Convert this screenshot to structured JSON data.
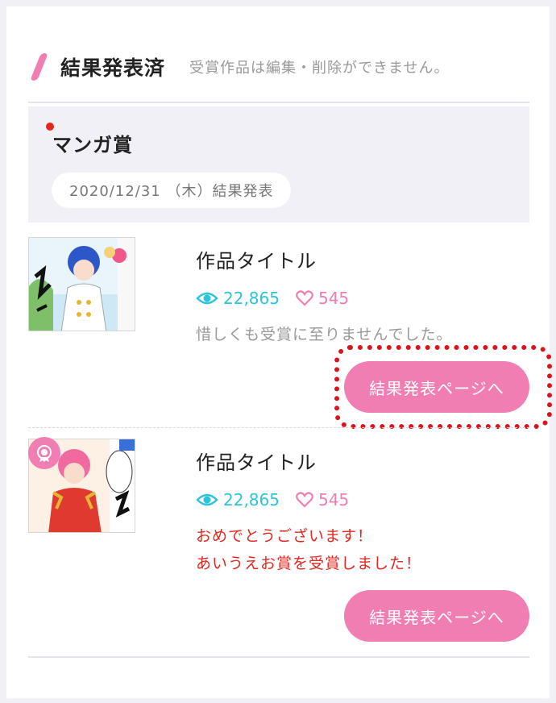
{
  "section": {
    "title": "結果発表済",
    "note": "受賞作品は編集・削除ができません。"
  },
  "contest": {
    "name": "マンガ賞",
    "date": "2020/12/31 （木）結果発表"
  },
  "entries": [
    {
      "title": "作品タイトル",
      "views": "22,865",
      "likes": "545",
      "message_lines": [
        "惜しくも受賞に至りませんでした。"
      ],
      "status": "not-awarded",
      "button_label": "結果発表ページへ"
    },
    {
      "title": "作品タイトル",
      "views": "22,865",
      "likes": "545",
      "message_lines": [
        "おめでとうございます！",
        "あいうえお賞を受賞しました！"
      ],
      "status": "awarded",
      "button_label": "結果発表ページへ"
    }
  ],
  "colors": {
    "accent_pink": "#f07eb2",
    "views_cyan": "#2cc4d8",
    "award_red": "#e6251f",
    "highlight_red": "#d9141c"
  },
  "icons": [
    "slash-accent-icon",
    "eye-icon",
    "heart-icon",
    "award-rosette-icon"
  ]
}
